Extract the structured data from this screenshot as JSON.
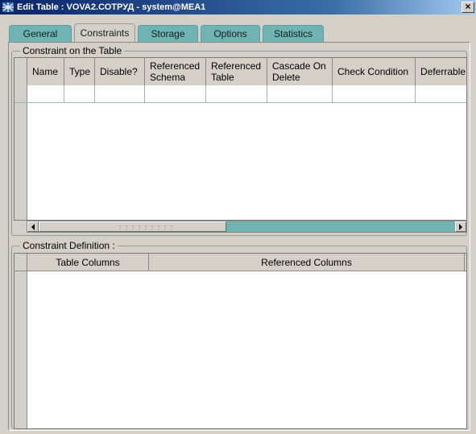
{
  "window": {
    "title": "Edit Table : VOVA2.СОТРУД - system@MEA1",
    "close_glyph": "×"
  },
  "tabs": [
    {
      "label": "General"
    },
    {
      "label": "Constraints",
      "active": true
    },
    {
      "label": "Storage"
    },
    {
      "label": "Options"
    },
    {
      "label": "Statistics"
    }
  ],
  "constraints_group": {
    "title": "Constraint on the Table",
    "columns": [
      "Name",
      "Type",
      "Disable?",
      "Referenced\nSchema",
      "Referenced\nTable",
      "Cascade On\nDelete",
      "Check Condition",
      "Deferrable"
    ]
  },
  "definition_group": {
    "title": "Constraint Definition :",
    "columns": [
      "Table Columns",
      "Referenced Columns"
    ]
  },
  "scrollbar": {
    "position_fraction": 0.0,
    "visible_fraction": 0.45
  },
  "colors": {
    "tab": "#6fb3b3",
    "titlebar_start": "#0a246a",
    "titlebar_end": "#a6caf0",
    "scroll_track": "#6fb3b3"
  }
}
